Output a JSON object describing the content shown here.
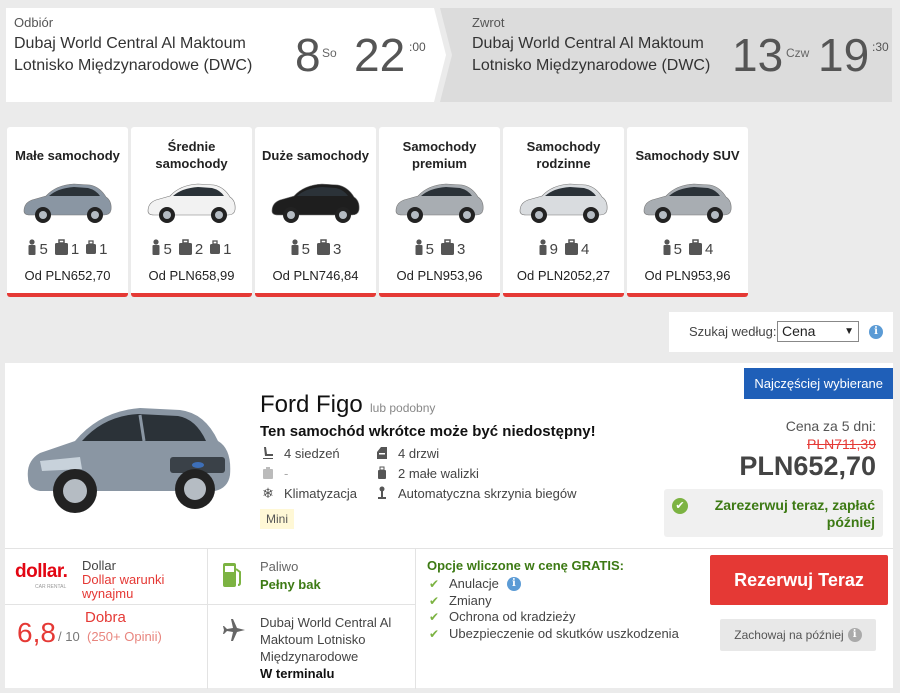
{
  "trip": {
    "pickup": {
      "label": "Odbiór",
      "location": "Dubaj World Central Al Maktoum Lotnisko Międzynarodowe (DWC)",
      "day": "8",
      "dow": "So",
      "hour": "22",
      "minute": ":00"
    },
    "dropoff": {
      "label": "Zwrot",
      "location": "Dubaj World Central Al Maktoum Lotnisko Międzynarodowe (DWC)",
      "day": "13",
      "dow": "Czw",
      "hour": "19",
      "minute": ":30"
    }
  },
  "categories": [
    {
      "name": "Małe samochody",
      "seats": "5",
      "bags_large": "1",
      "bags_small": "1",
      "price": "Od PLN652,70"
    },
    {
      "name": "Średnie samochody",
      "seats": "5",
      "bags_large": "2",
      "bags_small": "1",
      "price": "Od PLN658,99"
    },
    {
      "name": "Duże samochody",
      "seats": "5",
      "bags_large": "3",
      "bags_small": "",
      "price": "Od PLN746,84"
    },
    {
      "name": "Samochody premium",
      "seats": "5",
      "bags_large": "3",
      "bags_small": "",
      "price": "Od PLN953,96"
    },
    {
      "name": "Samochody rodzinne",
      "seats": "9",
      "bags_large": "4",
      "bags_small": "",
      "price": "Od PLN2052,27"
    },
    {
      "name": "Samochody SUV",
      "seats": "5",
      "bags_large": "4",
      "bags_small": "",
      "price": "Od PLN953,96"
    }
  ],
  "search": {
    "label": "Szukaj według:",
    "selected": "Cena"
  },
  "result": {
    "badge": "Najczęściej wybierane",
    "car_name": "Ford Figo",
    "similar": "lub podobny",
    "warning": "Ten samochód wkrótce może być niedostępny!",
    "specs": {
      "seats": "4 siedzeń",
      "doors": "4 drzwi",
      "large_bags": "-",
      "small_bags": "2 małe walizki",
      "ac": "Klimatyzacja",
      "transmission": "Automatyczna skrzynia biegów"
    },
    "class_tag": "Mini",
    "price_label": "Cena za 5 dni:",
    "old_price": "PLN711,39",
    "price": "PLN652,70",
    "pay_later": "Zarezerwuj teraz, zapłać później",
    "supplier": {
      "logo_text": "dollar.",
      "logo_sub": "CAR RENTAL",
      "name": "Dollar",
      "terms_link": "Dollar warunki wynajmu"
    },
    "rating": {
      "score": "6,8",
      "label": "Dobra",
      "out_of": "/ 10",
      "count": "(250+ Opinii)"
    },
    "fuel": {
      "label": "Paliwo",
      "value": "Pełny bak"
    },
    "pickup_location": {
      "name": "Dubaj World Central Al Maktoum Lotnisko Międzynarodowe",
      "terminal": "W terminalu"
    },
    "included_title": "Opcje wliczone w cenę GRATIS:",
    "included": [
      "Anulacje",
      "Zmiany",
      "Ochrona od kradzieży",
      "Ubezpieczenie od skutków uszkodzenia"
    ],
    "reserve_label": "Rezerwuj Teraz",
    "save_later_label": "Zachowaj na później"
  },
  "colors": {
    "accent_red": "#e53935",
    "badge_blue": "#1f5fb8",
    "green": "#3d7a14"
  }
}
